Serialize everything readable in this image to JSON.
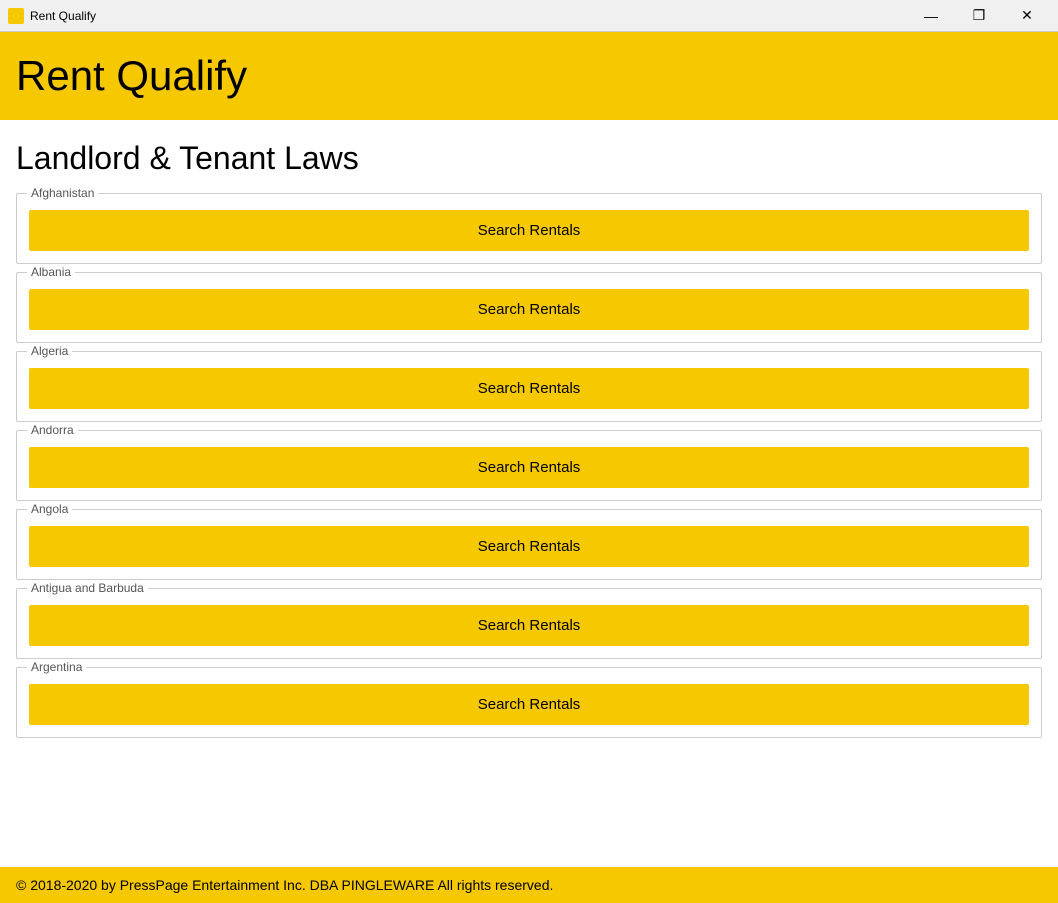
{
  "titleBar": {
    "title": "Rent Qualify",
    "minimizeLabel": "—",
    "maximizeLabel": "❐",
    "closeLabel": "✕"
  },
  "header": {
    "appTitle": "Rent Qualify"
  },
  "main": {
    "pageHeading": "Landlord & Tenant Laws",
    "countries": [
      {
        "name": "Afghanistan",
        "buttonLabel": "Search Rentals"
      },
      {
        "name": "Albania",
        "buttonLabel": "Search Rentals"
      },
      {
        "name": "Algeria",
        "buttonLabel": "Search Rentals"
      },
      {
        "name": "Andorra",
        "buttonLabel": "Search Rentals"
      },
      {
        "name": "Angola",
        "buttonLabel": "Search Rentals"
      },
      {
        "name": "Antigua and Barbuda",
        "buttonLabel": "Search Rentals"
      },
      {
        "name": "Argentina",
        "buttonLabel": "Search Rentals"
      }
    ]
  },
  "footer": {
    "text": "© 2018-2020 by PressPage Entertainment Inc. DBA PINGLEWARE All rights reserved."
  }
}
